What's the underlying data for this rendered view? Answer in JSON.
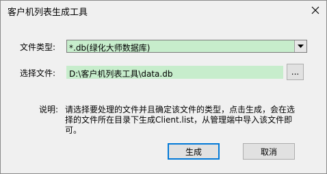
{
  "window": {
    "title": "客户机列表生成工具"
  },
  "form": {
    "type_label": "文件类型:",
    "type_value": "*.db(绿化大师数据库)",
    "file_label": "选择文件:",
    "file_value": "D:\\客户机列表工具\\data.db",
    "browse_label": "..."
  },
  "note": {
    "prefix": "说明:",
    "text": "请选择要处理的文件并且确定该文件的类型，点击生成，会在选择的文件所在目录下生成Client.list，从管理端中导入该文件即可。"
  },
  "buttons": {
    "generate": "生成",
    "cancel": "取消"
  },
  "icons": {
    "close": "close-icon",
    "dropdown": "chevron-down-icon"
  },
  "colors": {
    "field_bg": "#c7edcc",
    "focus_border": "#0078d7"
  }
}
